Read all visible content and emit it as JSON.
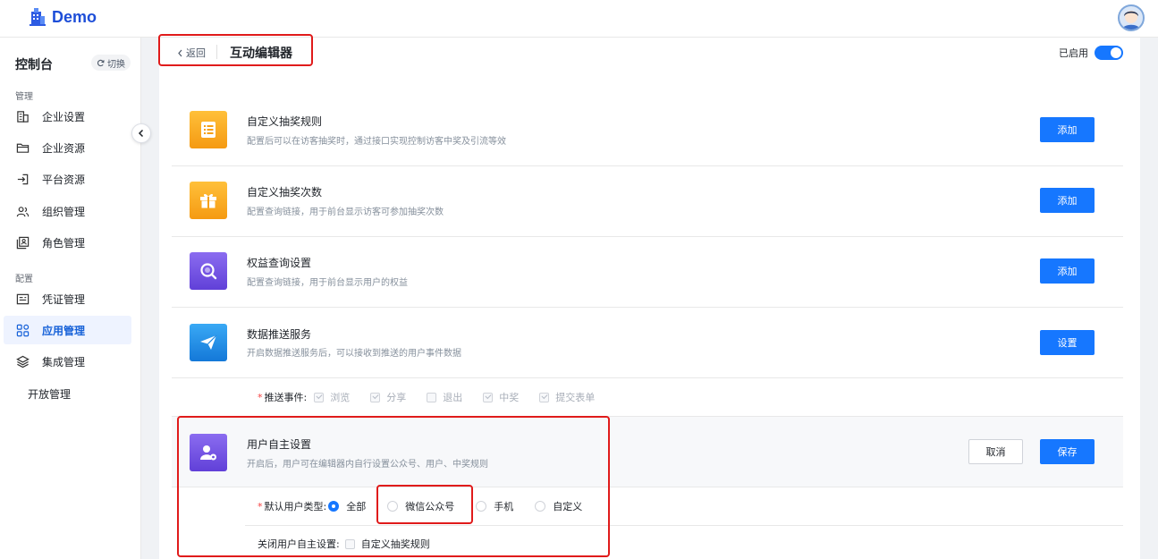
{
  "app": {
    "logo_text": "Demo"
  },
  "sidebar": {
    "console": "控制台",
    "switch_label": "切换",
    "section_manage": "管理",
    "section_config": "配置",
    "items": [
      {
        "label": "企业设置",
        "icon": "building-icon"
      },
      {
        "label": "企业资源",
        "icon": "folder-icon"
      },
      {
        "label": "平台资源",
        "icon": "login-icon"
      },
      {
        "label": "组织管理",
        "icon": "users-icon"
      },
      {
        "label": "角色管理",
        "icon": "id-card-icon"
      },
      {
        "label": "凭证管理",
        "icon": "credential-icon"
      },
      {
        "label": "应用管理",
        "icon": "apps-grid-icon",
        "active": true
      },
      {
        "label": "集成管理",
        "icon": "layers-icon"
      },
      {
        "label": "开放管理",
        "icon": ""
      }
    ]
  },
  "header": {
    "back_label": "返回",
    "title": "互动编辑器",
    "enabled_label": "已启用",
    "enabled": true
  },
  "items": [
    {
      "title": "自定义抽奖规则",
      "desc": "配置后可以在访客抽奖时，通过接口实现控制访客中奖及引流等效",
      "button": "添加",
      "icon": "list-icon",
      "color": "#f7a31c"
    },
    {
      "title": "自定义抽奖次数",
      "desc": "配置查询链接，用于前台显示访客可参加抽奖次数",
      "button": "添加",
      "icon": "gift-icon",
      "color": "#f7a31c"
    },
    {
      "title": "权益查询设置",
      "desc": "配置查询链接，用于前台显示用户的权益",
      "button": "添加",
      "icon": "magnifier-icon",
      "color": "#6b4fe0"
    },
    {
      "title": "数据推送服务",
      "desc": "开启数据推送服务后，可以接收到推送的用户事件数据",
      "button": "设置",
      "icon": "paper-plane-icon",
      "color": "#1e8fe6"
    },
    {
      "title": "用户自主设置",
      "desc": "开启后，用户可在编辑器内自行设置公众号、用户、中奖规则",
      "cancel": "取消",
      "save": "保存",
      "icon": "user-gear-icon",
      "color": "#6b4fe0"
    }
  ],
  "push_events": {
    "label": "推送事件:",
    "options": [
      {
        "label": "浏览",
        "checked": true
      },
      {
        "label": "分享",
        "checked": true
      },
      {
        "label": "退出",
        "checked": false
      },
      {
        "label": "中奖",
        "checked": true
      },
      {
        "label": "提交表单",
        "checked": true
      }
    ]
  },
  "default_user_type": {
    "label": "默认用户类型:",
    "options": [
      {
        "label": "全部",
        "selected": true
      },
      {
        "label": "微信公众号",
        "selected": false
      },
      {
        "label": "手机",
        "selected": false
      },
      {
        "label": "自定义",
        "selected": false
      }
    ]
  },
  "close_user_setting": {
    "label": "关闭用户自主设置:",
    "option": "自定义抽奖规则"
  },
  "colors": {
    "primary": "#1677ff",
    "annotation": "#e01b1b"
  }
}
